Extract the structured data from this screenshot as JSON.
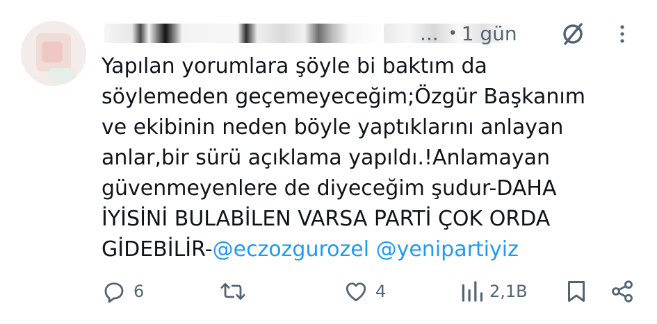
{
  "author": {
    "timestamp": "1 gün"
  },
  "tweet": {
    "text_plain": "Yapılan yorumlara şöyle bi baktım da\nsöylemeden geçemeyeceğim;Özgür Başkanım\nve ekibinin neden böyle yaptıklarını anlayan\nanlar,bir sürü açıklama yapıldı.!Anlamayan\ngüvenmeyenlere de diyeceğim şudur-DAHA\nİYİSİNİ BULABİLEN VARSA PARTİ ÇOK ORDA\nGİDEBİLİR-",
    "mention1": "@eczozgurozel",
    "mention2": "@yenipartiyiz"
  },
  "actions": {
    "replies": "6",
    "reposts": "",
    "likes": "4",
    "views": "2,1B"
  },
  "colors": {
    "text": "#0f1419",
    "muted": "#536471",
    "link": "#1d9bf0"
  },
  "icons": [
    "reply-icon",
    "repost-icon",
    "like-icon",
    "views-icon",
    "bookmark-icon",
    "share-icon",
    "grok-icon",
    "more-icon"
  ]
}
